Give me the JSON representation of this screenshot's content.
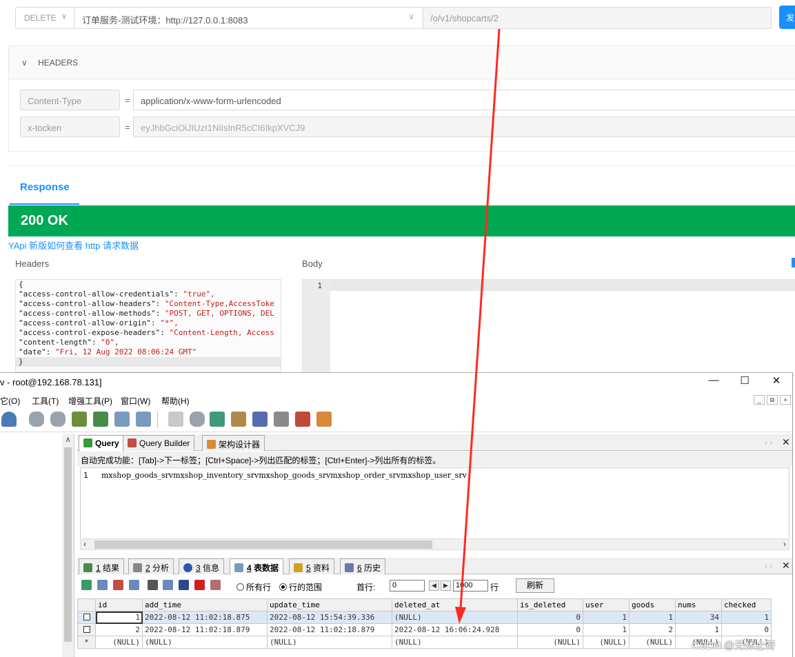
{
  "yapi": {
    "method": "DELETE",
    "environment": "订单服务-测试环境：http://127.0.0.1:8083",
    "path": "/o/v1/shopcarts/2",
    "send_label": "发",
    "headers_section_title": "HEADERS",
    "headers": [
      {
        "key": "Content-Type",
        "eq": "=",
        "value": "application/x-www-form-urlencoded"
      },
      {
        "key": "x-tocken",
        "eq": "=",
        "value": "eyJhbGciOiJIUzI1NiIsInR5cCI6IkpXVCJ9"
      }
    ],
    "response_tab": "Response",
    "status": "200 OK",
    "help_link": "YApi 新版如何查看 http 请求数据",
    "headers_label": "Headers",
    "body_label": "Body",
    "response_headers_lines": [
      {
        "key": "{",
        "val": ""
      },
      {
        "key": "  \"access-control-allow-credentials\": ",
        "val": "\"true\","
      },
      {
        "key": "  \"access-control-allow-headers\": ",
        "val": "\"Content-Type,AccessToke"
      },
      {
        "key": "  \"access-control-allow-methods\": ",
        "val": "\"POST, GET, OPTIONS, DEL"
      },
      {
        "key": "  \"access-control-allow-origin\": ",
        "val": "\"*\","
      },
      {
        "key": "  \"access-control-expose-headers\": ",
        "val": "\"Content-Length, Access"
      },
      {
        "key": "  \"content-length\": ",
        "val": "\"0\","
      },
      {
        "key": "  \"date\": ",
        "val": "\"Fri, 12 Aug 2022 08:06:24 GMT\""
      },
      {
        "key": "}",
        "val": ""
      }
    ],
    "body_line_number": "1"
  },
  "sqlyog": {
    "window_title": "v - root@192.168.78.131]",
    "menu": [
      "它(O)",
      "工具(T)",
      "增强工具(P)",
      "窗口(W)",
      "帮助(H)"
    ],
    "query_tabs": [
      "Query",
      "Query Builder",
      "架构设计器"
    ],
    "autocomplete_hint": "自动完成功能：[Tab]->下一标签；[Ctrl+Space]->列出匹配的标签；[Ctrl+Enter]->列出所有的标签。",
    "editor_line_number": "1",
    "editor_text": "mxshop_goods_srvmxshop_inventory_srvmxshop_goods_srvmxshop_order_srvmxshop_user_srv",
    "result_tabs": [
      {
        "num": "1",
        "label": " 结果"
      },
      {
        "num": "2",
        "label": " 分析"
      },
      {
        "num": "3",
        "label": " 信息"
      },
      {
        "num": "4",
        "label": " 表数据"
      },
      {
        "num": "5",
        "label": " 资料"
      },
      {
        "num": "6",
        "label": " 历史"
      }
    ],
    "radio_all": "所有行",
    "radio_range": "行的范围",
    "first_row_label": "首行:",
    "first_row_value": "0",
    "row_count_value": "1000",
    "rows_label": "行",
    "refresh_label": "刷新",
    "columns": [
      "id",
      "add_time",
      "update_time",
      "deleted_at",
      "is_deleted",
      "user",
      "goods",
      "nums",
      "checked"
    ],
    "rows": [
      [
        "1",
        "2022-08-12 11:02:18.875",
        "2022-08-12 15:54:39.336",
        "(NULL)",
        "0",
        "1",
        "1",
        "34",
        "1"
      ],
      [
        "2",
        "2022-08-12 11:02:18.879",
        "2022-08-12 11:02:18.879",
        "2022-08-12 16:06:24.928",
        "0",
        "1",
        "2",
        "1",
        "0"
      ],
      [
        "(NULL)",
        "(NULL)",
        "(NULL)",
        "(NULL)",
        "(NULL)",
        "(NULL)",
        "(NULL)",
        "(NULL)",
        "(NULL)"
      ]
    ],
    "new_row_marker": "*"
  },
  "watermark": "CSDN @无休止符",
  "colors": {
    "status_green": "#00a854",
    "link_blue": "#1890ff",
    "annotation_red": "#ff2a1f"
  }
}
